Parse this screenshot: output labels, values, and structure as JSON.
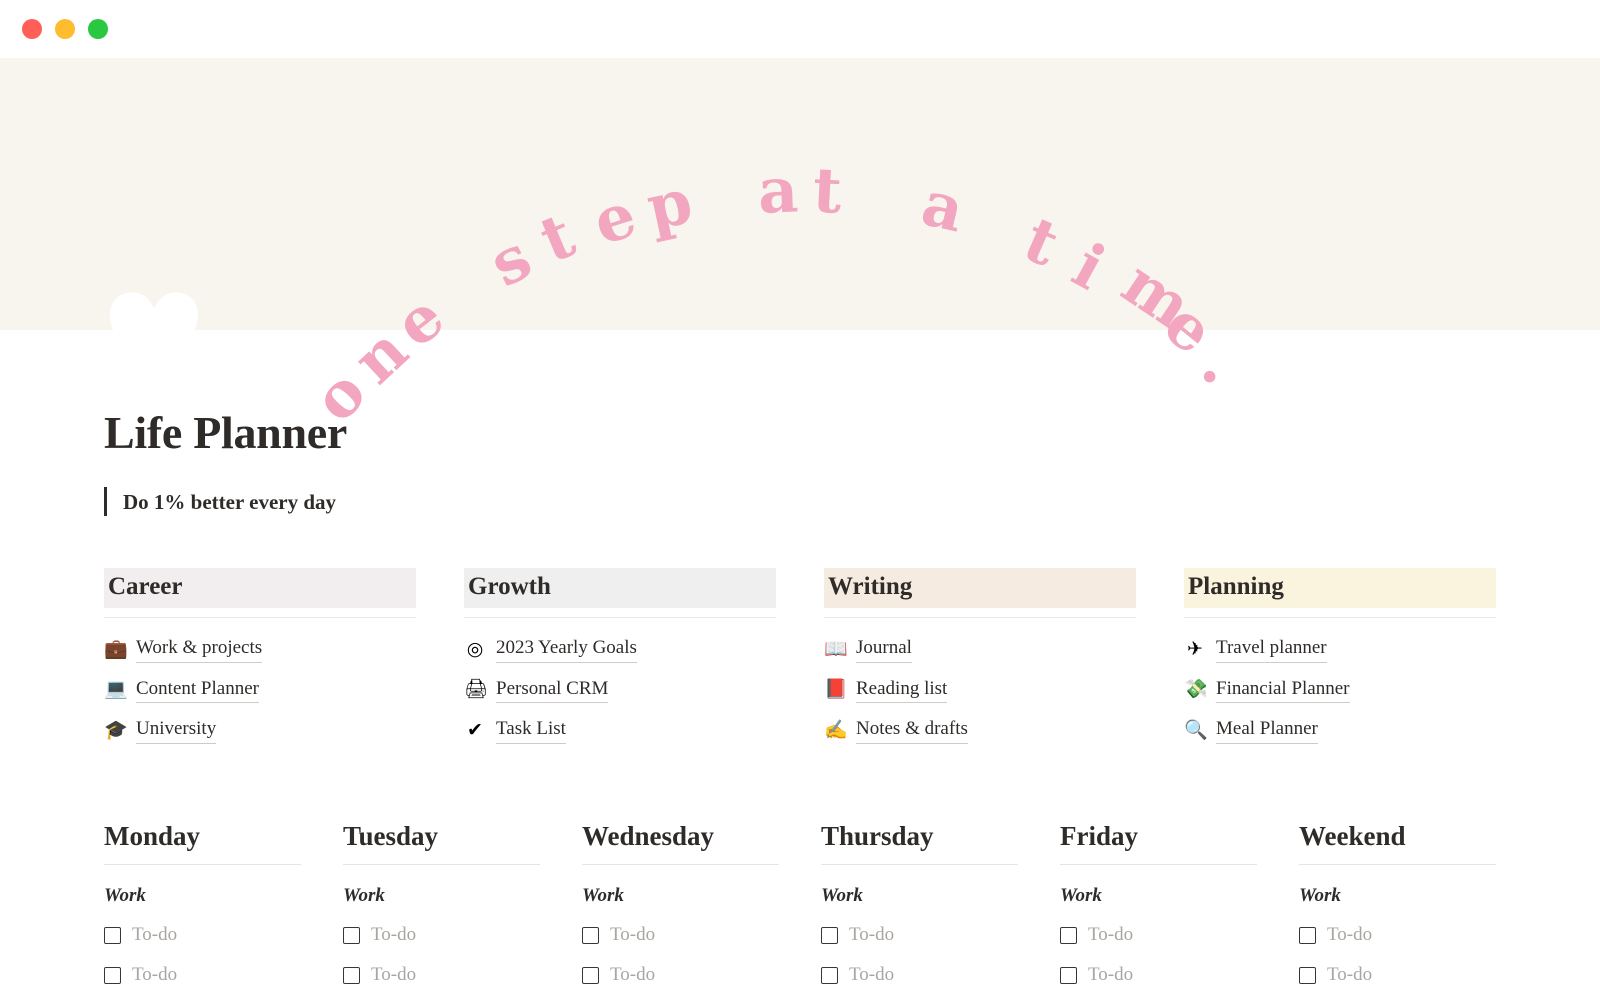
{
  "window": {
    "traffic_lights": [
      {
        "name": "close",
        "color": "#FF5F57"
      },
      {
        "name": "minimize",
        "color": "#FEBC2E"
      },
      {
        "name": "maximize",
        "color": "#28C840"
      }
    ]
  },
  "cover": {
    "background_color": "#F8F5EE",
    "banner_text": "one step at a time.",
    "banner_text_color": "#F2A6C0",
    "page_icon": "🤍",
    "page_icon_name": "white-heart-emoji"
  },
  "header": {
    "title": "Life Planner",
    "subtitle": "Do 1% better every day"
  },
  "categories": [
    {
      "heading": "Career",
      "highlight_color": "#F2EDEE",
      "items": [
        {
          "emoji": "💼",
          "icon_name": "briefcase-icon",
          "label": "Work & projects"
        },
        {
          "emoji": "💻",
          "icon_name": "laptop-icon",
          "label": "Content Planner"
        },
        {
          "emoji": "🎓",
          "icon_name": "graduation-cap-icon",
          "label": "University"
        }
      ]
    },
    {
      "heading": "Growth",
      "highlight_color": "#EFEFEF",
      "items": [
        {
          "emoji": "◎",
          "icon_name": "target-icon",
          "label": "2023 Yearly Goals"
        },
        {
          "emoji": "🖨",
          "icon_name": "printer-icon",
          "label": "Personal CRM"
        },
        {
          "emoji": "✔",
          "icon_name": "checkmark-icon",
          "label": "Task List"
        }
      ]
    },
    {
      "heading": "Writing",
      "highlight_color": "#F6EBE0",
      "items": [
        {
          "emoji": "📖",
          "icon_name": "open-book-icon",
          "label": "Journal"
        },
        {
          "emoji": "📕",
          "icon_name": "closed-book-icon",
          "label": "Reading list"
        },
        {
          "emoji": "✍",
          "icon_name": "writing-hand-icon",
          "label": "Notes & drafts"
        }
      ]
    },
    {
      "heading": "Planning",
      "highlight_color": "#FAF3DD",
      "items": [
        {
          "emoji": "✈",
          "icon_name": "airplane-icon",
          "label": "Travel planner"
        },
        {
          "emoji": "💸",
          "icon_name": "money-with-wings-icon",
          "label": "Financial Planner"
        },
        {
          "emoji": "🔍",
          "icon_name": "magnifying-glass-icon",
          "label": "Meal Planner"
        }
      ]
    }
  ],
  "week": {
    "group_label": "Work",
    "todo_placeholder": "To-do",
    "todo_rows_per_day": 2,
    "days": [
      {
        "name": "Monday"
      },
      {
        "name": "Tuesday"
      },
      {
        "name": "Wednesday"
      },
      {
        "name": "Thursday"
      },
      {
        "name": "Friday"
      },
      {
        "name": "Weekend"
      }
    ]
  }
}
